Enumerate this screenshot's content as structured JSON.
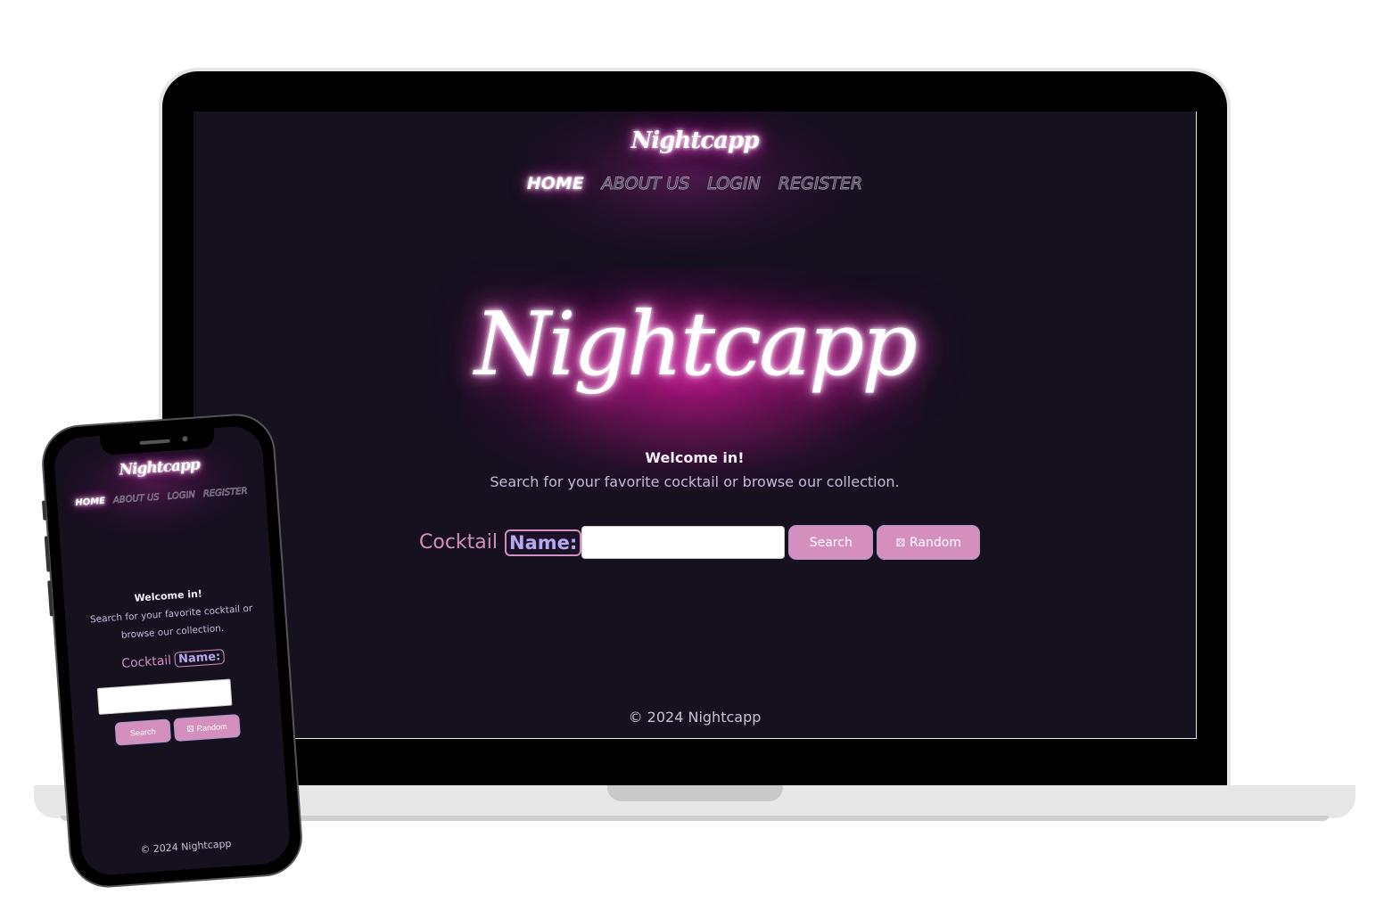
{
  "brand": {
    "name": "Nightcapp"
  },
  "nav": {
    "items": [
      {
        "label": "HOME",
        "active": true
      },
      {
        "label": "ABOUT US",
        "active": false
      },
      {
        "label": "LOGIN",
        "active": false
      },
      {
        "label": "REGISTER",
        "active": false
      }
    ]
  },
  "hero": {
    "title": "Nightcapp",
    "welcome": "Welcome in!",
    "subtitle": "Search for your favorite cocktail or browse our collection."
  },
  "search": {
    "label_prefix": "Cocktail",
    "label_name": "Name:",
    "input_value": "",
    "search_button": "Search",
    "random_button": "Random",
    "random_icon": "dice-icon"
  },
  "footer": {
    "text": "© 2024 Nightcapp"
  },
  "colors": {
    "background": "#16101f",
    "accent_pink": "#d48fbd",
    "label_lavender": "#b8a8f0",
    "neon_glow": "#c01890"
  },
  "devices": [
    "laptop",
    "phone"
  ]
}
